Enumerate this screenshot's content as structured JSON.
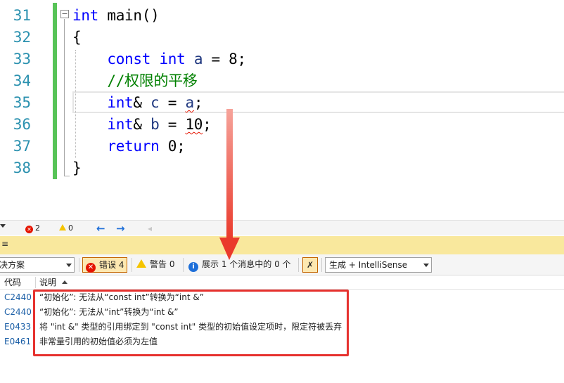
{
  "editor": {
    "lines": [
      {
        "num": "31",
        "tokens": [
          {
            "t": "int",
            "c": "kw"
          },
          {
            "t": " main()",
            "c": ""
          }
        ]
      },
      {
        "num": "32",
        "tokens": [
          {
            "t": "{",
            "c": ""
          }
        ]
      },
      {
        "num": "33",
        "tokens": [
          {
            "t": "    ",
            "c": ""
          },
          {
            "t": "const",
            "c": "kw"
          },
          {
            "t": " ",
            "c": ""
          },
          {
            "t": "int",
            "c": "kw"
          },
          {
            "t": " ",
            "c": ""
          },
          {
            "t": "a",
            "c": "id"
          },
          {
            "t": " = 8;",
            "c": ""
          }
        ]
      },
      {
        "num": "34",
        "tokens": [
          {
            "t": "    ",
            "c": ""
          },
          {
            "t": "//权限的平移",
            "c": "cm"
          }
        ]
      },
      {
        "num": "35",
        "tokens": [
          {
            "t": "    ",
            "c": ""
          },
          {
            "t": "int",
            "c": "kw"
          },
          {
            "t": "& ",
            "c": ""
          },
          {
            "t": "c",
            "c": "id"
          },
          {
            "t": " = ",
            "c": ""
          },
          {
            "t": "a",
            "c": "id squiggle"
          },
          {
            "t": ";",
            "c": ""
          }
        ]
      },
      {
        "num": "36",
        "tokens": [
          {
            "t": "    ",
            "c": ""
          },
          {
            "t": "int",
            "c": "kw"
          },
          {
            "t": "& ",
            "c": ""
          },
          {
            "t": "b",
            "c": "id"
          },
          {
            "t": " = ",
            "c": ""
          },
          {
            "t": "10",
            "c": "squiggle"
          },
          {
            "t": ";",
            "c": ""
          }
        ]
      },
      {
        "num": "37",
        "tokens": [
          {
            "t": "    ",
            "c": ""
          },
          {
            "t": "return",
            "c": "kw"
          },
          {
            "t": " 0;",
            "c": ""
          }
        ]
      },
      {
        "num": "38",
        "tokens": [
          {
            "t": "}",
            "c": ""
          }
        ]
      }
    ],
    "fold_glyph": "−"
  },
  "status_strip": {
    "error_count": "2",
    "warning_count": "0",
    "back_arrow": "←",
    "forward_arrow": "→",
    "left_arrow": "◂",
    "err_glyph": "✕"
  },
  "panel": {
    "title": "≡",
    "scope_dropdown": "决方案",
    "errors_label": "错误 4",
    "warnings_label": "警告 0",
    "messages_label": "展示 1 个消息中的 0 个",
    "build_dropdown": "生成 + IntelliSense",
    "filter_glyph": "✗",
    "err_x": "✕",
    "info_i": "i"
  },
  "columns": {
    "code": "代码",
    "description": "说明"
  },
  "errors": [
    {
      "code": "C2440",
      "description": "“初始化”: 无法从“const int”转换为“int &”"
    },
    {
      "code": "C2440",
      "description": "“初始化”: 无法从“int”转换为“int &”"
    },
    {
      "code": "E0433",
      "description": "将 \"int &\" 类型的引用绑定到 \"const int\" 类型的初始值设定项时，限定符被丢弃"
    },
    {
      "code": "E0461",
      "description": "非常量引用的初始值必须为左值"
    }
  ],
  "colors": {
    "annotation_red": "#e6312e",
    "keyword_blue": "#0000ff",
    "comment_green": "#008000",
    "line_number": "#2b91af"
  }
}
